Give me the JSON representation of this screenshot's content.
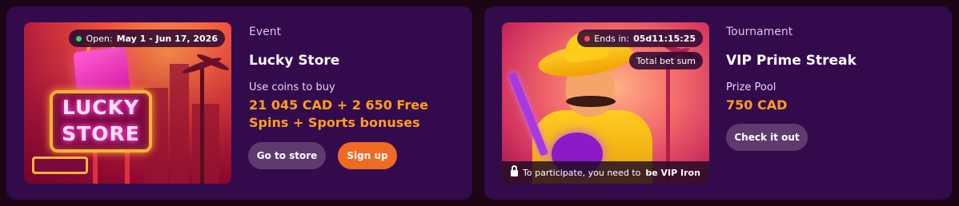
{
  "event_card": {
    "badge_prefix": "Open:",
    "badge_dates": "May 1 - Jun 17, 2026",
    "art_sign_line1": "LUCKY",
    "art_sign_line2": "STORE",
    "kind": "Event",
    "title": "Lucky Store",
    "sublabel": "Use coins to buy",
    "reward_line1": "21 045 CAD + 2 650 Free",
    "reward_line2": "Spins + Sports bonuses",
    "secondary_button": "Go to store",
    "primary_button": "Sign up"
  },
  "tournament_card": {
    "badge_prefix": "Ends in:",
    "badge_countdown": "05d11:15:25",
    "tag": "Total bet sum",
    "lock_text_prefix": "To participate, you need to",
    "lock_text_bold": "be VIP Iron",
    "kind": "Tournament",
    "title": "VIP Prime Streak",
    "sublabel": "Prize Pool",
    "prize": "750 CAD",
    "button": "Check it out"
  },
  "colors": {
    "page_bg": "#1c0515",
    "card_bg": "#330a4c",
    "accent_orange": "#ff9f1e",
    "primary_button": "#f06a24",
    "secondary_button": "#5e3b6f",
    "open_dot": "#2ed07a",
    "ends_dot": "#ff4a6a"
  },
  "icons": {
    "status_open": "green-dot-icon",
    "status_ends": "red-dot-icon",
    "lock": "lock-icon"
  }
}
